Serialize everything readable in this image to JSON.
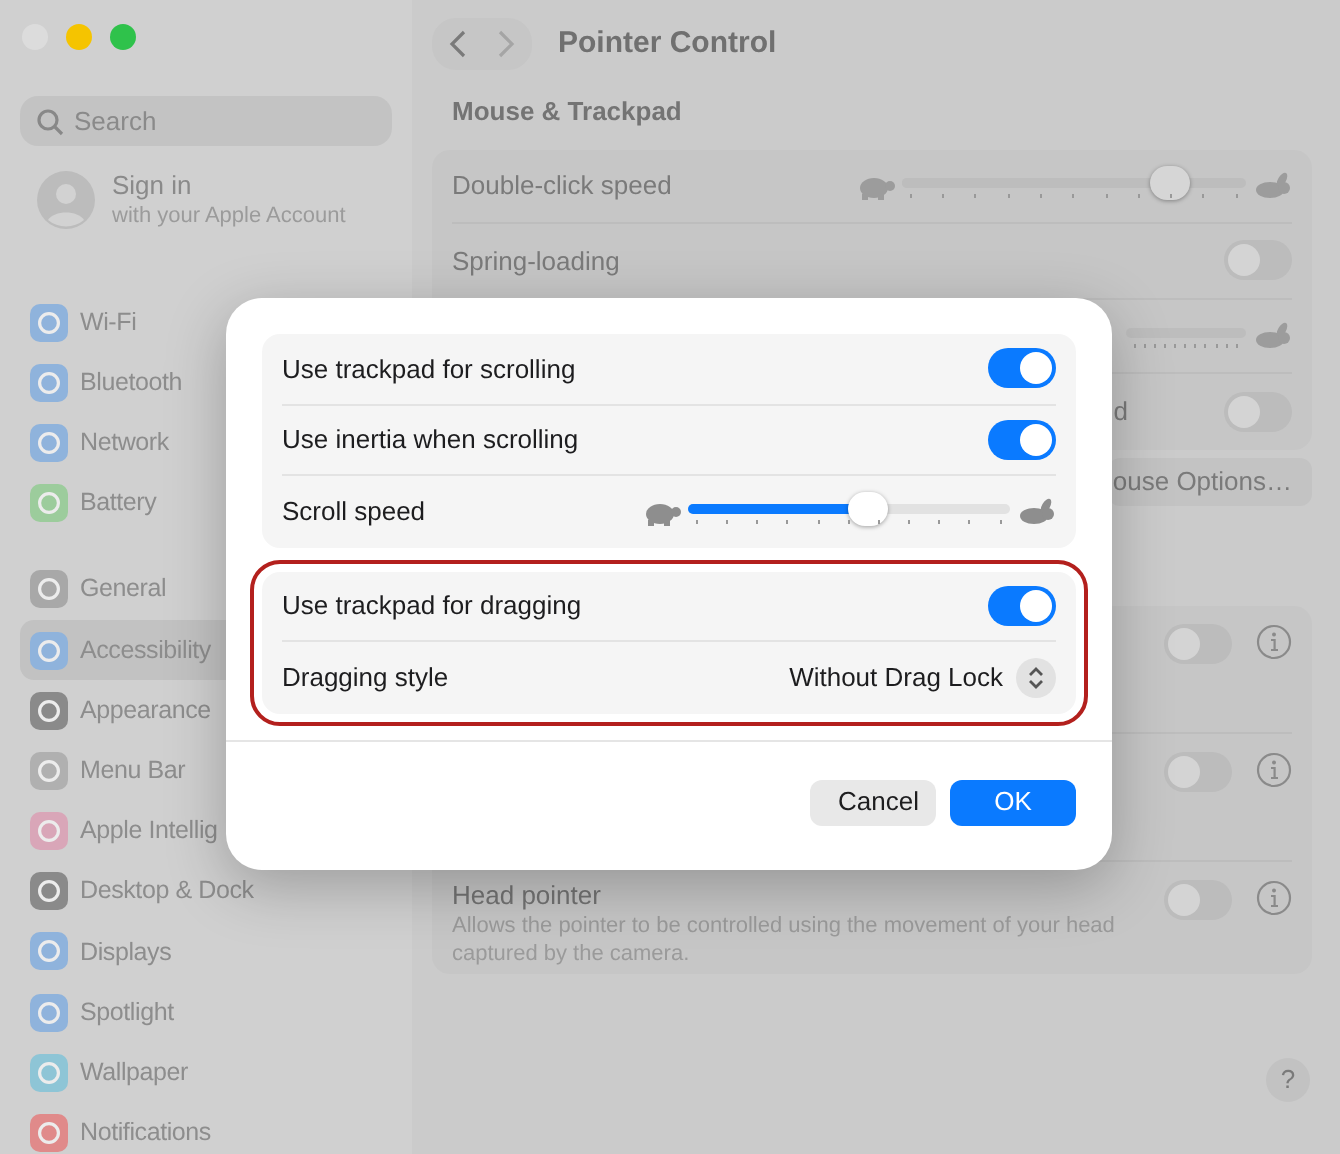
{
  "sidebar": {
    "search": {
      "placeholder": "Search"
    },
    "account": {
      "title": "Sign in",
      "subtitle": "with your Apple Account"
    },
    "sections": [
      [
        {
          "label": "Wi-Fi",
          "selected": false
        },
        {
          "label": "Bluetooth",
          "selected": false
        },
        {
          "label": "Network",
          "selected": false
        },
        {
          "label": "Battery",
          "selected": false
        }
      ],
      [
        {
          "label": "General",
          "selected": false
        },
        {
          "label": "Accessibility",
          "selected": true
        },
        {
          "label": "Appearance",
          "selected": false
        },
        {
          "label": "Menu Bar",
          "selected": false
        },
        {
          "label": "Apple Intellig",
          "selected": false
        },
        {
          "label": "Desktop & Dock",
          "selected": false
        },
        {
          "label": "Displays",
          "selected": false
        },
        {
          "label": "Spotlight",
          "selected": false
        },
        {
          "label": "Wallpaper",
          "selected": false
        },
        {
          "label": "Notifications",
          "selected": false
        }
      ]
    ]
  },
  "header": {
    "title": "Pointer Control"
  },
  "section_title": "Mouse & Trackpad",
  "settings": [
    {
      "kind": "slider",
      "label": "Double-click speed",
      "level": 0.78
    },
    {
      "kind": "toggle",
      "label": "Spring-loading",
      "on": false
    },
    {
      "kind": "covered_slider"
    },
    {
      "kind": "toggle",
      "label": "d",
      "on": false
    }
  ],
  "options_button": "ouse Options…",
  "accessibility_rows": [
    {
      "on": false
    },
    {
      "on": false
    },
    {
      "label": "Head pointer",
      "description": "Allows the pointer to be controlled using the movement of your head captured by the camera.",
      "on": false
    }
  ],
  "help": "?",
  "dialog": {
    "groups": [
      {
        "highlighted": false,
        "rows": [
          {
            "kind": "toggle",
            "label": "Use trackpad for scrolling",
            "on": true
          },
          {
            "kind": "toggle",
            "label": "Use inertia when scrolling",
            "on": true
          },
          {
            "kind": "slider",
            "label": "Scroll speed",
            "level": 0.56
          }
        ]
      },
      {
        "highlighted": true,
        "rows": [
          {
            "kind": "toggle",
            "label": "Use trackpad for dragging",
            "on": true
          },
          {
            "kind": "popup",
            "label": "Dragging style",
            "value": "Without Drag Lock"
          }
        ]
      }
    ],
    "buttons": [
      {
        "label": "Cancel",
        "kind": "secondary"
      },
      {
        "label": "OK",
        "kind": "primary"
      }
    ]
  }
}
